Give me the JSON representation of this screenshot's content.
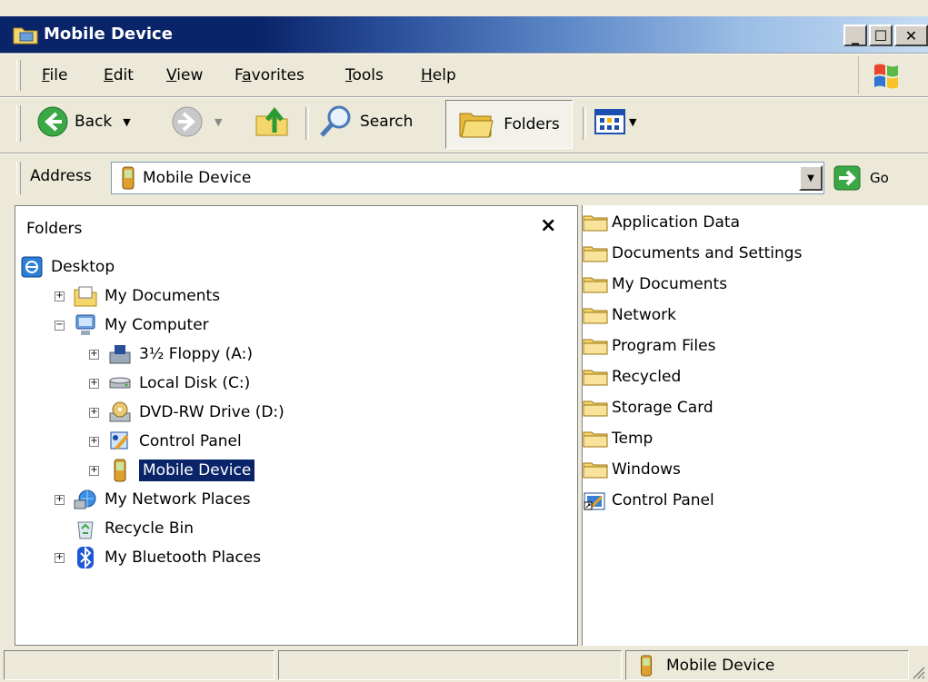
{
  "window": {
    "title": "Mobile Device"
  },
  "menu": [
    {
      "label": "File",
      "key": "F"
    },
    {
      "label": "Edit",
      "key": "E"
    },
    {
      "label": "View",
      "key": "V"
    },
    {
      "label": "Favorites",
      "key": "a"
    },
    {
      "label": "Tools",
      "key": "T"
    },
    {
      "label": "Help",
      "key": "H"
    }
  ],
  "toolbar": {
    "back_label": "Back",
    "search_label": "Search",
    "folders_label": "Folders"
  },
  "address": {
    "label": "Address",
    "value": "Mobile Device",
    "go_label": "Go"
  },
  "folders_pane": {
    "title": "Folders",
    "close": "×",
    "tree": [
      {
        "label": "Desktop",
        "icon": "desktop-icon",
        "indent": 0,
        "expander": ""
      },
      {
        "label": "My Documents",
        "icon": "my-documents-icon",
        "indent": 1,
        "expander": "+"
      },
      {
        "label": "My Computer",
        "icon": "my-computer-icon",
        "indent": 1,
        "expander": "−"
      },
      {
        "label": "3½ Floppy (A:)",
        "icon": "floppy-icon",
        "indent": 2,
        "expander": "+"
      },
      {
        "label": "Local Disk (C:)",
        "icon": "local-disk-icon",
        "indent": 2,
        "expander": "+"
      },
      {
        "label": "DVD-RW Drive (D:)",
        "icon": "dvd-drive-icon",
        "indent": 2,
        "expander": "+"
      },
      {
        "label": "Control Panel",
        "icon": "control-panel-icon",
        "indent": 2,
        "expander": "+"
      },
      {
        "label": "Mobile Device",
        "icon": "mobile-device-icon",
        "indent": 2,
        "expander": "+",
        "selected": true
      },
      {
        "label": "My Network Places",
        "icon": "network-places-icon",
        "indent": 1,
        "expander": "+"
      },
      {
        "label": "Recycle Bin",
        "icon": "recycle-bin-icon",
        "indent": 1,
        "expander": ""
      },
      {
        "label": "My Bluetooth Places",
        "icon": "bluetooth-icon",
        "indent": 1,
        "expander": "+"
      }
    ]
  },
  "content": {
    "items": [
      {
        "label": "Application Data",
        "icon": "folder-icon"
      },
      {
        "label": "Documents and Settings",
        "icon": "folder-icon"
      },
      {
        "label": "My Documents",
        "icon": "folder-icon"
      },
      {
        "label": "Network",
        "icon": "folder-icon"
      },
      {
        "label": "Program Files",
        "icon": "folder-icon"
      },
      {
        "label": "Recycled",
        "icon": "folder-icon"
      },
      {
        "label": "Storage Card",
        "icon": "folder-icon"
      },
      {
        "label": "Temp",
        "icon": "folder-icon"
      },
      {
        "label": "Windows",
        "icon": "folder-icon"
      },
      {
        "label": "Control Panel",
        "icon": "control-panel-shortcut-icon"
      }
    ]
  },
  "statusbar": {
    "location": "Mobile Device"
  },
  "colors": {
    "selection": "#0a246a",
    "folder": "#f5d66b",
    "titlebar": "#0a246a"
  }
}
